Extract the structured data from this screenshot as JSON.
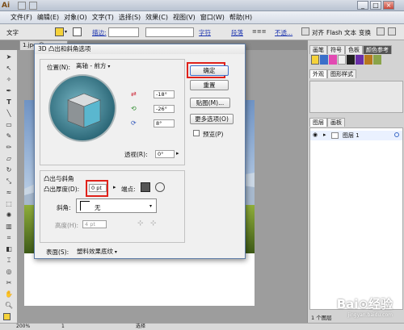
{
  "app": {
    "logo": "Ai",
    "window_buttons": [
      "_",
      "□",
      "×"
    ]
  },
  "menu": [
    "文件(F)",
    "编辑(E)",
    "对象(O)",
    "文字(T)",
    "选择(S)",
    "效果(C)",
    "视图(V)",
    "窗口(W)",
    "帮助(H)"
  ],
  "control_bar": {
    "label": "文字",
    "stroke_link": "描边:",
    "char_link": "字符",
    "para_link": "段落",
    "opacity_link": "不透...",
    "align_label": "对齐",
    "flash_label": "Flash 文本",
    "transform_label": "变换"
  },
  "document": {
    "tab": "1.jpg @ ..."
  },
  "dialog": {
    "title": "3D 凸出和斜角选项",
    "position_label": "位置(N):",
    "position_value": "离轴 - 前方",
    "angle_x": "-18°",
    "angle_y": "-26°",
    "angle_z": "8°",
    "perspective_label": "透视(R):",
    "perspective_value": "0°",
    "extrude_group": "凸出与斜角",
    "extrude_depth_label": "凸出厚度(D):",
    "extrude_depth_value": "0 pt",
    "cap_label": "端点:",
    "bevel_label": "斜角:",
    "bevel_value": "无",
    "height_label": "高度(H):",
    "height_value": "4 pt",
    "surface_label": "表面(S):",
    "surface_value": "塑料效果底纹",
    "ok": "确定",
    "reset": "重置",
    "map": "贴图(M)...",
    "more": "更多选项(O)",
    "preview": "预览(P)"
  },
  "right_panel": {
    "swatch_tabs": [
      "画笔",
      "符号",
      "色板",
      "颜色参考"
    ],
    "appearance_tabs": [
      "外观",
      "图形样式"
    ],
    "layers_tabs": [
      "图层",
      "画板"
    ],
    "layer_name": "图层 1",
    "layer_count": "1 个图层"
  },
  "status": {
    "zoom": "200%",
    "page": "1",
    "mode": "选择"
  },
  "watermark": {
    "text": "Bai⊙经验",
    "sub": "jingyan.baidu.com"
  }
}
